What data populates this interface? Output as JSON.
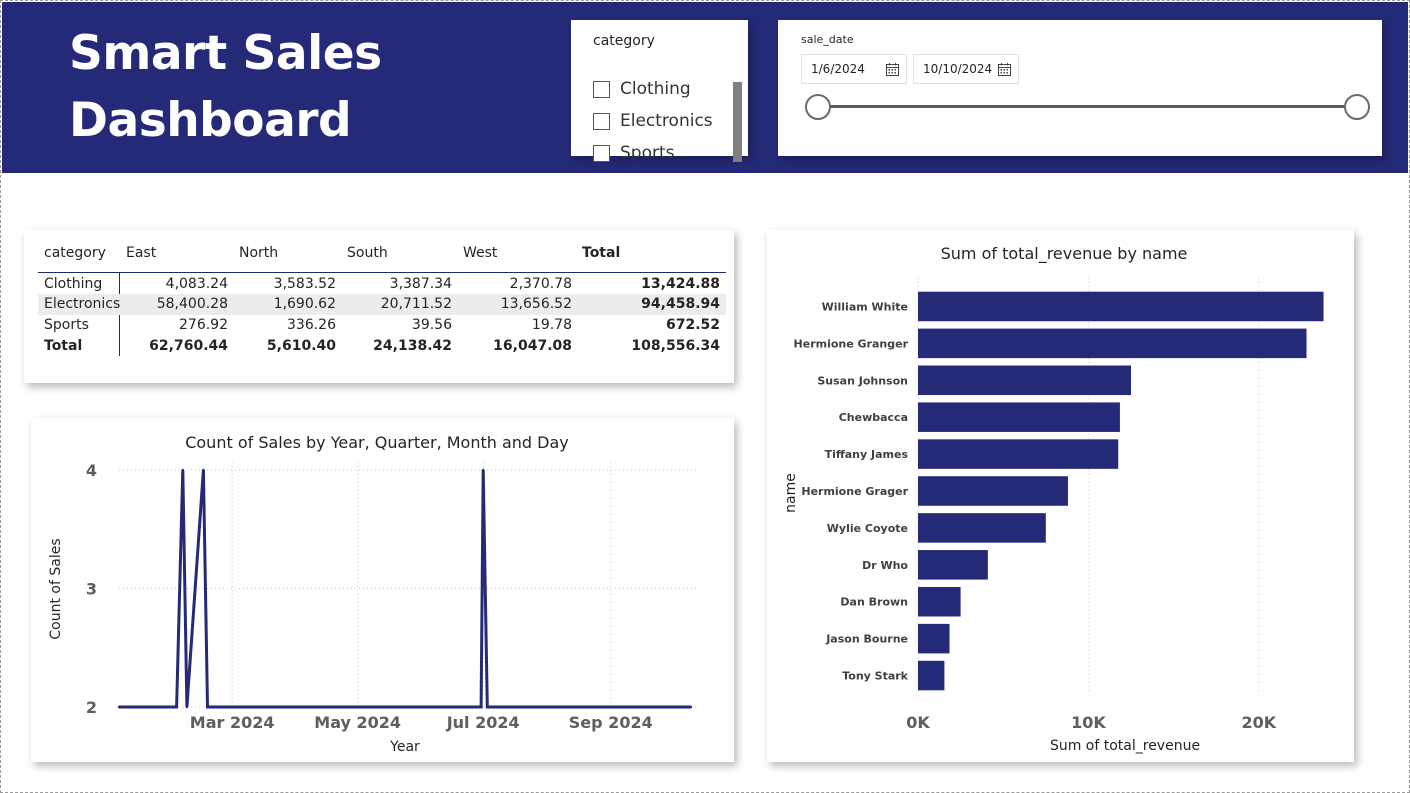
{
  "header": {
    "title_line1": "Smart Sales",
    "title_line2": "Dashboard"
  },
  "colors": {
    "header_bg": "#252a78",
    "series": "#252a78"
  },
  "category_slicer": {
    "title": "category",
    "items": [
      {
        "label": "Clothing",
        "checked": false
      },
      {
        "label": "Electronics",
        "checked": false
      },
      {
        "label": "Sports",
        "checked": false
      }
    ]
  },
  "date_slicer": {
    "title": "sale_date",
    "start": "1/6/2024",
    "end": "10/10/2024",
    "start_icon": "calendar-icon",
    "end_icon": "calendar-icon"
  },
  "matrix": {
    "headers": [
      "category",
      "East",
      "North",
      "South",
      "West",
      "Total"
    ],
    "rows": [
      {
        "label": "Clothing",
        "values": [
          "4,083.24",
          "3,583.52",
          "3,387.34",
          "2,370.78"
        ],
        "total": "13,424.88"
      },
      {
        "label": "Electronics",
        "values": [
          "58,400.28",
          "1,690.62",
          "20,711.52",
          "13,656.52"
        ],
        "total": "94,458.94"
      },
      {
        "label": "Sports",
        "values": [
          "276.92",
          "336.26",
          "39.56",
          "19.78"
        ],
        "total": "672.52"
      }
    ],
    "total_row": {
      "label": "Total",
      "values": [
        "62,760.44",
        "5,610.40",
        "24,138.42",
        "16,047.08"
      ],
      "total": "108,556.34"
    }
  },
  "chart_data": [
    {
      "type": "line",
      "title": "Count of Sales by Year, Quarter, Month and Day",
      "xlabel": "Year",
      "ylabel": "Count of Sales",
      "x_tick_labels": [
        "Mar 2024",
        "May 2024",
        "Jul 2024",
        "Sep 2024"
      ],
      "y_tick_labels": [
        "4",
        "3",
        "2"
      ],
      "ylim": [
        2,
        4
      ],
      "xlim": [
        "2024-01-06",
        "2024-10-10"
      ],
      "grid": true,
      "series": [
        {
          "points": [
            {
              "x": "2024-01-06",
              "y": 2
            },
            {
              "x": "2024-02-03",
              "y": 2
            },
            {
              "x": "2024-02-06",
              "y": 4
            },
            {
              "x": "2024-02-08",
              "y": 2
            },
            {
              "x": "2024-02-16",
              "y": 4
            },
            {
              "x": "2024-02-18",
              "y": 2
            },
            {
              "x": "2024-06-30",
              "y": 2
            },
            {
              "x": "2024-07-01",
              "y": 4
            },
            {
              "x": "2024-07-03",
              "y": 2
            },
            {
              "x": "2024-10-10",
              "y": 2
            }
          ]
        }
      ]
    },
    {
      "type": "bar",
      "orientation": "horizontal",
      "title": "Sum of total_revenue by name",
      "xlabel": "Sum of total_revenue",
      "ylabel": "name",
      "x_tick_labels": [
        "0K",
        "10K",
        "20K"
      ],
      "xlim": [
        0,
        25000
      ],
      "grid": true,
      "categories": [
        "William White",
        "Hermione Granger",
        "Susan Johnson",
        "Chewbacca",
        "Tiffany James",
        "Hermione Grager",
        "Wylie Coyote",
        "Dr Who",
        "Dan Brown",
        "Jason Bourne",
        "Tony Stark"
      ],
      "values": [
        23800,
        22800,
        12500,
        11850,
        11750,
        8800,
        7500,
        4100,
        2500,
        1850,
        1550
      ]
    }
  ]
}
